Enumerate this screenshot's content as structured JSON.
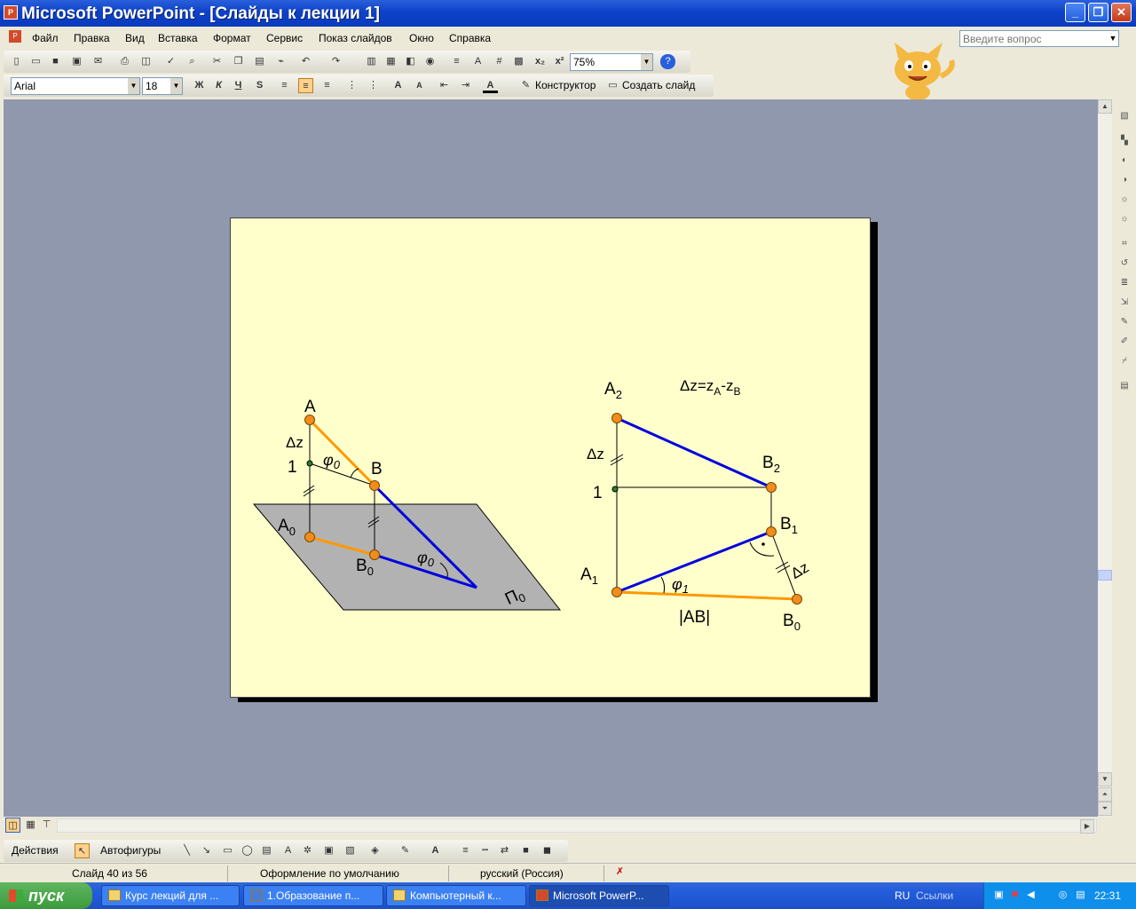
{
  "window": {
    "title": "Microsoft PowerPoint - [Слайды к лекции 1]",
    "app_icon": "P"
  },
  "window_buttons": {
    "minimize": "_",
    "restore": "❐",
    "close": "✕"
  },
  "menu": [
    "Файл",
    "Правка",
    "Вид",
    "Вставка",
    "Формат",
    "Сервис",
    "Показ слайдов",
    "Окно",
    "Справка"
  ],
  "help_box": {
    "placeholder": "Введите вопрос"
  },
  "toolbar": {
    "zoom": "75%",
    "font_name": "Arial",
    "font_size": "18",
    "bold": "Ж",
    "italic": "К",
    "underline": "Ч",
    "shadow": "S",
    "designer": "Конструктор",
    "new_slide": "Создать слайд"
  },
  "slide": {
    "left": {
      "A": "A",
      "B": "B",
      "A0": "A",
      "A0_sub": "0",
      "B0": "B",
      "B0_sub": "0",
      "dz": "Δz",
      "one": "1",
      "phi": "φ",
      "phi_sub": "0",
      "phi2": "φ",
      "phi2_sub": "0",
      "plane": "Π",
      "plane_sub": "0"
    },
    "right": {
      "A2": "A",
      "A2_sub": "2",
      "B2": "B",
      "B2_sub": "2",
      "B1": "B",
      "B1_sub": "1",
      "A1": "A",
      "A1_sub": "1",
      "B0": "B",
      "B0_sub": "0",
      "dz": "Δz",
      "dz2": "Δz",
      "one": "1",
      "phi": "φ",
      "phi_sub": "1",
      "formula_main": "Δz=z",
      "formula_subA": "A",
      "formula_dash": "-z",
      "formula_subB": "B",
      "length": "|AB|"
    },
    "colors": {
      "slide_bg": "#FFFFCC",
      "orange": "#FF9900",
      "blue": "#0000DD",
      "plane": "#B2B2B2",
      "point": "#F28C1A"
    }
  },
  "drawing_toolbar": {
    "actions": "Действия",
    "autoshapes": "Автофигуры"
  },
  "status": {
    "slide": "Слайд 40 из 56",
    "design": "Оформление по умолчанию",
    "language": "русский (Россия)"
  },
  "taskbar": {
    "start": "пуск",
    "tasks": [
      "Курс лекций для ...",
      "1.Образование п...",
      "Компьютерный к...",
      "Microsoft PowerP..."
    ],
    "lang": "RU",
    "links": "Ссылки",
    "clock": "22:31"
  }
}
